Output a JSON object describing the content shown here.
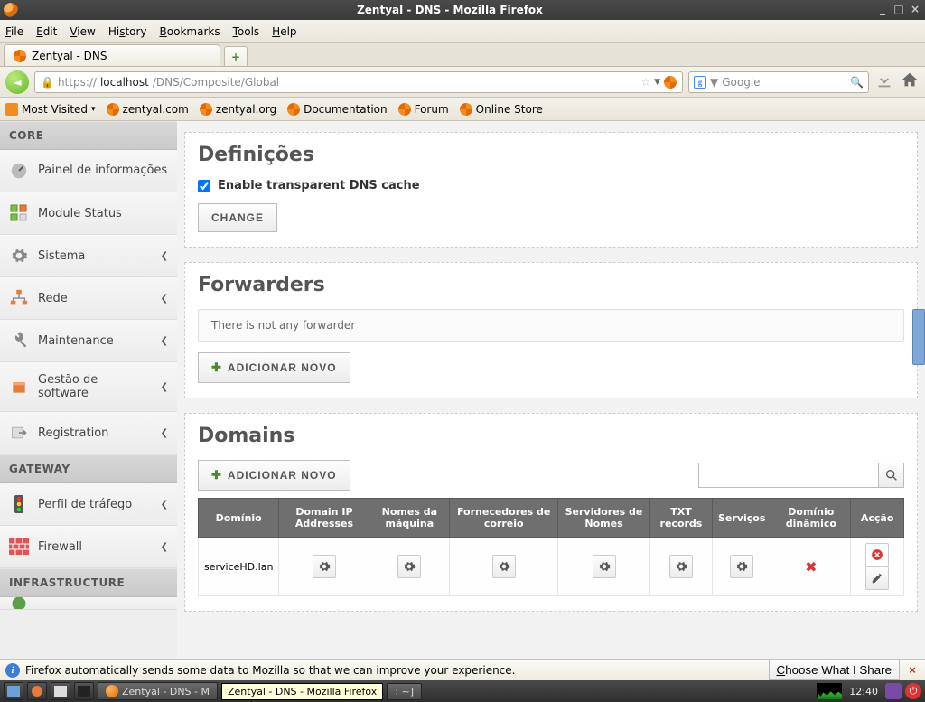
{
  "window": {
    "title": "Zentyal - DNS - Mozilla Firefox"
  },
  "menu": {
    "file": "File",
    "edit": "Edit",
    "view": "View",
    "history": "History",
    "bookmarks": "Bookmarks",
    "tools": "Tools",
    "help": "Help"
  },
  "tab": {
    "label": "Zentyal - DNS"
  },
  "url": {
    "scheme": "https://",
    "host": "localhost",
    "path": "/DNS/Composite/Global"
  },
  "search": {
    "engine": "Google",
    "placeholder": "Google"
  },
  "bookmarks": {
    "most_visited": "Most Visited",
    "zentyal_com": "zentyal.com",
    "zentyal_org": "zentyal.org",
    "documentation": "Documentation",
    "forum": "Forum",
    "online_store": "Online Store"
  },
  "sidebar": {
    "cat_core": "CORE",
    "cat_gateway": "GATEWAY",
    "cat_infra": "INFRASTRUCTURE",
    "items": {
      "dashboard": "Painel de informações",
      "module_status": "Module Status",
      "sistema": "Sistema",
      "rede": "Rede",
      "maintenance": "Maintenance",
      "software": "Gestão de software",
      "registration": "Registration",
      "traffic": "Perfil de tráfego",
      "firewall": "Firewall"
    }
  },
  "definicoes": {
    "title": "Definições",
    "checkbox_label": "Enable transparent DNS cache",
    "change_btn": "CHANGE"
  },
  "forwarders": {
    "title": "Forwarders",
    "empty": "There is not any forwarder",
    "add_btn": "ADICIONAR NOVO"
  },
  "domains": {
    "title": "Domains",
    "add_btn": "ADICIONAR NOVO",
    "cols": {
      "dominio": "Domínio",
      "ip": "Domain IP Addresses",
      "hostnames": "Nomes da máquina",
      "mail": "Fornecedores de correio",
      "ns": "Servidores de Nomes",
      "txt": "TXT records",
      "services": "Serviços",
      "dynamic": "Domínio dinâmico",
      "action": "Acção"
    },
    "rows": [
      {
        "domain": "serviceHD.lan"
      }
    ]
  },
  "infobar": {
    "msg": "Firefox automatically sends some data to Mozilla so that we can improve your experience.",
    "choose": "Choose What I Share"
  },
  "taskbar": {
    "task_label": "Zentyal - DNS - M",
    "tooltip": "Zentyal - DNS - Mozilla Firefox",
    "terminal": ": ~]",
    "clock": "12:40"
  }
}
